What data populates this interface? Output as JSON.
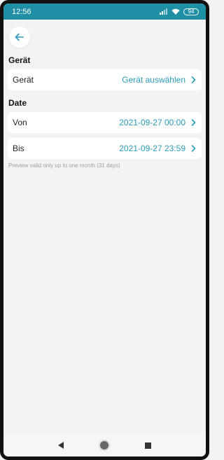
{
  "status_bar": {
    "time": "12:56",
    "battery": "94"
  },
  "sections": {
    "device": {
      "title": "Gerät",
      "row_label": "Gerät",
      "row_value": "Gerät auswählen"
    },
    "date": {
      "title": "Date",
      "from_label": "Von",
      "from_value": "2021-09-27 00:00",
      "to_label": "Bis",
      "to_value": "2021-09-27 23:59"
    }
  },
  "note": "Preview valid only up to one month (31 days)",
  "colors": {
    "status_bar": "#1f8fa6",
    "accent": "#2a9cba"
  },
  "icons": [
    "back-arrow-icon",
    "chevron-right-icon",
    "nav-back-icon",
    "nav-home-icon",
    "nav-recent-icon"
  ]
}
